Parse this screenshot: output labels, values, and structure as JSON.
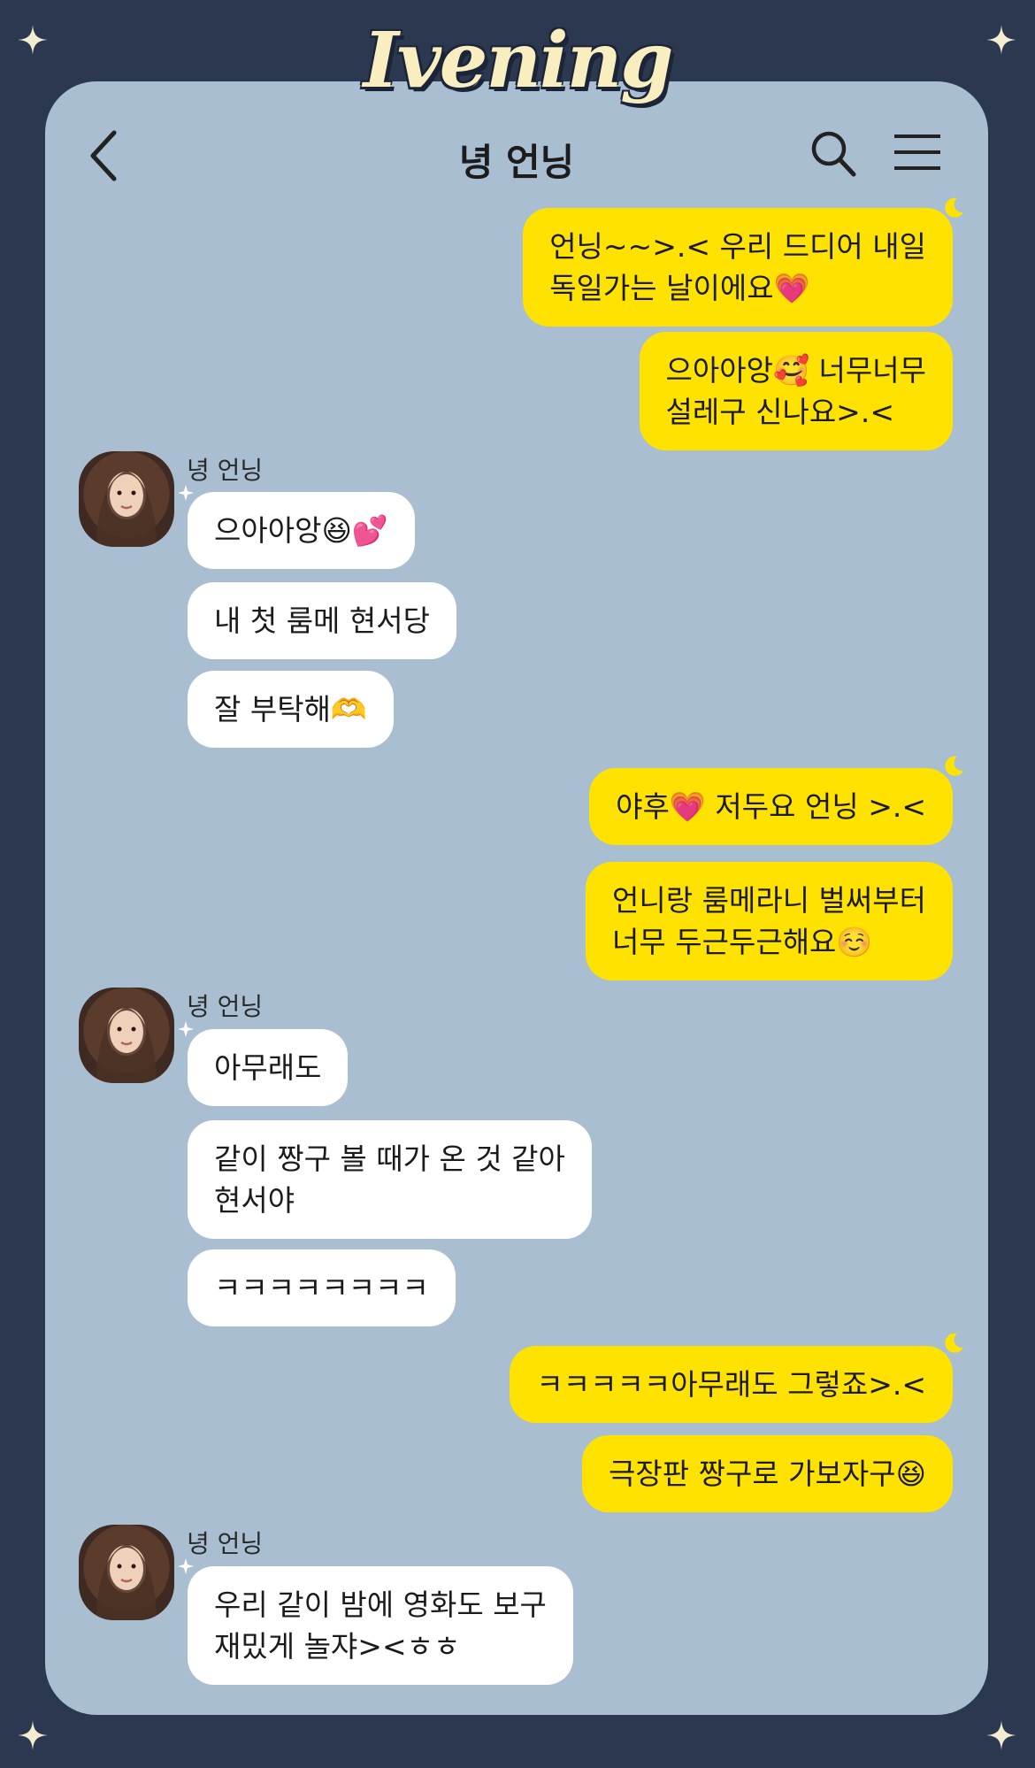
{
  "brand": {
    "logo_text": "Ivening"
  },
  "header": {
    "title": "녕 언닝"
  },
  "messages": [
    {
      "side": "me",
      "lines": [
        "언닝~~>.< 우리 드디어 내일",
        "독일가는 날이에요💗"
      ]
    },
    {
      "side": "me",
      "lines": [
        "으아아앙🥰 너무너무",
        "설레구 신나요>.<"
      ]
    },
    {
      "side": "them",
      "sender": "녕 언닝",
      "lines": [
        "으아아앙😆💕"
      ]
    },
    {
      "side": "them",
      "lines": [
        "내 첫 룸메 현서당"
      ]
    },
    {
      "side": "them",
      "lines": [
        "잘 부탁해🫶"
      ]
    },
    {
      "side": "me",
      "lines": [
        "야후💗 저두요 언닝 >.<"
      ]
    },
    {
      "side": "me",
      "lines": [
        "언니랑 룸메라니 벌써부터",
        "너무 두근두근해요☺️"
      ]
    },
    {
      "side": "them",
      "sender": "녕 언닝",
      "lines": [
        "아무래도"
      ]
    },
    {
      "side": "them",
      "lines": [
        "같이 짱구 볼 때가 온 것 같아",
        "현서야"
      ]
    },
    {
      "side": "them",
      "lines": [
        "ㅋㅋㅋㅋㅋㅋㅋㅋ"
      ]
    },
    {
      "side": "me",
      "lines": [
        "ㅋㅋㅋㅋㅋ아무래도 그렇죠>.<"
      ]
    },
    {
      "side": "me",
      "lines": [
        "극장판 짱구로 가보자구😆"
      ]
    },
    {
      "side": "them",
      "sender": "녕 언닝",
      "lines": [
        "우리 같이 밤에 영화도 보구",
        "재밌게 놀쟈><ㅎㅎ"
      ]
    }
  ],
  "colors": {
    "background": "#2c3850",
    "panel": "#a9bfd1",
    "my_bubble": "#ffe200",
    "their_bubble": "#ffffff",
    "logo": "#f9eec0"
  },
  "icons": [
    "back-arrow-icon",
    "search-icon",
    "menu-icon",
    "moon-icon",
    "sparkle-icon",
    "star-icon"
  ]
}
